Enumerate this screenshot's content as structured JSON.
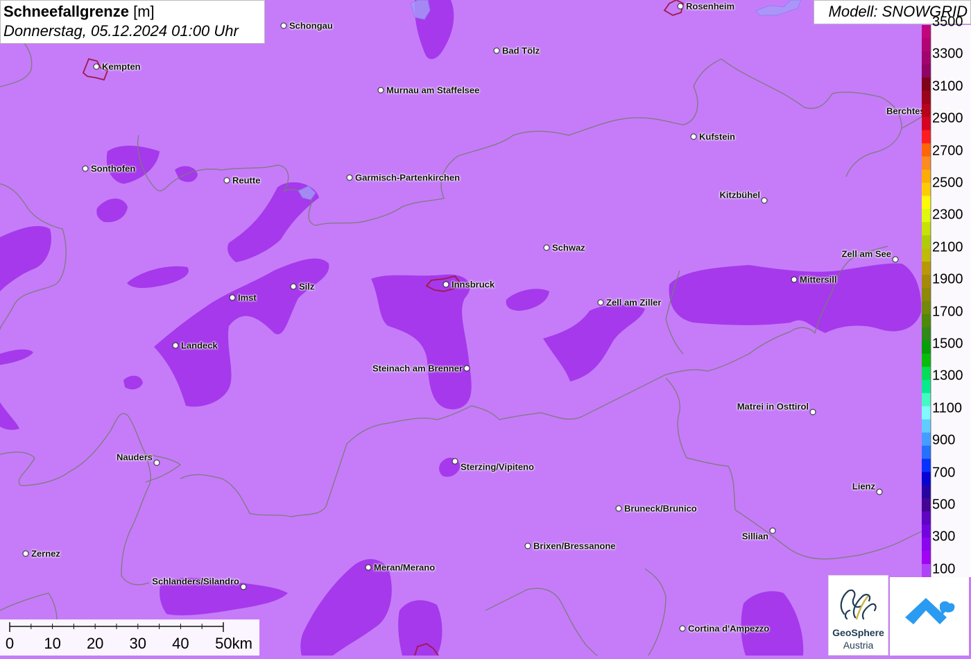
{
  "title": {
    "name": "Schneefallgrenze",
    "unit": "[m]",
    "datetime": "Donnerstag, 05.12.2024 01:00 Uhr"
  },
  "model": "Modell: SNOWGRID",
  "colors": {
    "background": "#c67cf9",
    "snow_zone": "#a232ea",
    "border_line": "#7a7a7a",
    "city_outline": "#9e1a4a"
  },
  "legend": {
    "labels": [
      "3500",
      "3300",
      "3100",
      "2900",
      "2700",
      "2500",
      "2300",
      "2100",
      "1900",
      "1700",
      "1500",
      "1300",
      "1100",
      "900",
      "700",
      "500",
      "300",
      "100"
    ],
    "colors": [
      "#c2007a",
      "#b30071",
      "#a10068",
      "#8f005f",
      "#7d0010",
      "#9a0010",
      "#b80014",
      "#d6001a",
      "#ff1a1a",
      "#ff6600",
      "#ff8c1a",
      "#ffb000",
      "#ffd000",
      "#ffff00",
      "#dfff00",
      "#c8e600",
      "#b0d000",
      "#bfbf00",
      "#b89a00",
      "#a58a00",
      "#8c8a00",
      "#6f8a00",
      "#4a8a00",
      "#2a8a10",
      "#00a000",
      "#00c000",
      "#00e050",
      "#00f08a",
      "#40ffc0",
      "#80ffff",
      "#60d0ff",
      "#40a0ff",
      "#2070ff",
      "#0030ff",
      "#0000d0",
      "#2000a0",
      "#400090",
      "#5a00c0",
      "#7000e0",
      "#8a00f0",
      "#a000f5",
      "#b040f8"
    ]
  },
  "scale": {
    "labels": [
      "0",
      "10",
      "20",
      "30",
      "40",
      "50km"
    ]
  },
  "cities": [
    {
      "name": "Schongau",
      "key": "schongau"
    },
    {
      "name": "Rosenheim",
      "key": "rosenheim"
    },
    {
      "name": "Kempten",
      "key": "kempten"
    },
    {
      "name": "Bad Tölz",
      "key": "bad-toelz"
    },
    {
      "name": "Murnau am Staffelsee",
      "key": "murnau"
    },
    {
      "name": "Berchtesgaden",
      "key": "berchtesgaden"
    },
    {
      "name": "Kufstein",
      "key": "kufstein"
    },
    {
      "name": "Sonthofen",
      "key": "sonthofen"
    },
    {
      "name": "Reutte",
      "key": "reutte"
    },
    {
      "name": "Garmisch-Partenkirchen",
      "key": "garmisch"
    },
    {
      "name": "Kitzbühel",
      "key": "kitzbuehel"
    },
    {
      "name": "Schwaz",
      "key": "schwaz"
    },
    {
      "name": "Zell am See",
      "key": "zell-am-see"
    },
    {
      "name": "Mittersill",
      "key": "mittersill"
    },
    {
      "name": "Silz",
      "key": "silz"
    },
    {
      "name": "Innsbruck",
      "key": "innsbruck"
    },
    {
      "name": "Imst",
      "key": "imst"
    },
    {
      "name": "Zell am Ziller",
      "key": "zell-am-ziller"
    },
    {
      "name": "Landeck",
      "key": "landeck"
    },
    {
      "name": "Steinach am Brenner",
      "key": "steinach"
    },
    {
      "name": "Matrei in Osttirol",
      "key": "matrei"
    },
    {
      "name": "Nauders",
      "key": "nauders"
    },
    {
      "name": "Sterzing/Vipiteno",
      "key": "sterzing"
    },
    {
      "name": "Lienz",
      "key": "lienz"
    },
    {
      "name": "Bruneck/Brunico",
      "key": "bruneck"
    },
    {
      "name": "Sillian",
      "key": "sillian"
    },
    {
      "name": "Brixen/Bressanone",
      "key": "brixen"
    },
    {
      "name": "Zernez",
      "key": "zernez"
    },
    {
      "name": "Meran/Merano",
      "key": "meran"
    },
    {
      "name": "Schlanders/Silandro",
      "key": "schlanders"
    },
    {
      "name": "Cortina d'Ampezzo",
      "key": "cortina"
    }
  ],
  "logos": {
    "geosphere_name": "GeoSphere",
    "geosphere_sub": "Austria"
  }
}
